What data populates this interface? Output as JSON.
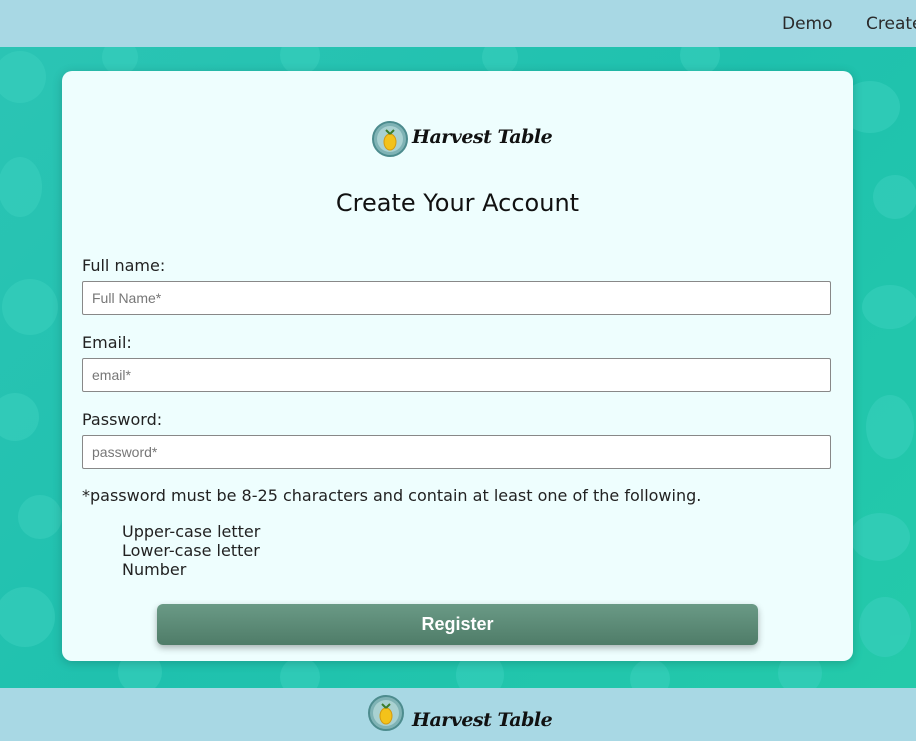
{
  "nav": {
    "demo_label": "Demo",
    "create_label": "Create"
  },
  "brand": {
    "name": "Harvest Table"
  },
  "form": {
    "title": "Create Your Account",
    "full_name": {
      "label": "Full name:",
      "placeholder": "Full Name*",
      "value": ""
    },
    "email": {
      "label": "Email:",
      "placeholder": "email*",
      "value": ""
    },
    "password": {
      "label": "Password:",
      "placeholder": "password*",
      "value": ""
    },
    "password_note": "*password must be 8-25 characters and contain at least one of the following.",
    "requirements": [
      "Upper-case letter",
      "Lower-case letter",
      "Number"
    ],
    "register_label": "Register"
  },
  "colors": {
    "header_bg": "#a8d8e4",
    "page_bg": "#1fc7b0",
    "card_bg": "#eefefe",
    "button": "#5a8a75"
  },
  "icons": {
    "logo": "lemon-badge-icon"
  }
}
